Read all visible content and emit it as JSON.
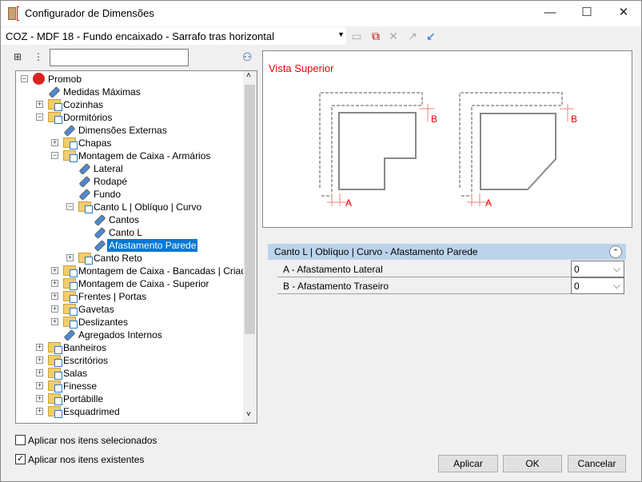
{
  "window": {
    "title": "Configurador de Dimensões",
    "min": "—",
    "max": "☐",
    "close": "✕"
  },
  "toolbar": {
    "combo_value": "COZ - MDF 18 - Fundo encaixado - Sarrafo tras horizontal"
  },
  "search": {
    "value": ""
  },
  "tree": [
    {
      "label": "Promob",
      "level": 0,
      "exp": "-",
      "icon": "logo"
    },
    {
      "label": "Medidas Máximas",
      "level": 1,
      "icon": "tag"
    },
    {
      "label": "Cozinhas",
      "level": 1,
      "exp": "+",
      "icon": "folder"
    },
    {
      "label": "Dormitórios",
      "level": 1,
      "exp": "-",
      "icon": "folder"
    },
    {
      "label": "Dimensões Externas",
      "level": 2,
      "icon": "tag"
    },
    {
      "label": "Chapas",
      "level": 2,
      "exp": "+",
      "icon": "folder"
    },
    {
      "label": "Montagem de Caixa - Armários",
      "level": 2,
      "exp": "-",
      "icon": "folder"
    },
    {
      "label": "Lateral",
      "level": 3,
      "icon": "tag"
    },
    {
      "label": "Rodapé",
      "level": 3,
      "icon": "tag"
    },
    {
      "label": "Fundo",
      "level": 3,
      "icon": "tag"
    },
    {
      "label": "Canto L | Oblíquo | Curvo",
      "level": 3,
      "exp": "-",
      "icon": "folder"
    },
    {
      "label": "Cantos",
      "level": 4,
      "icon": "tag"
    },
    {
      "label": "Canto L",
      "level": 4,
      "icon": "tag"
    },
    {
      "label": "Afastamento Parede",
      "level": 4,
      "icon": "tag",
      "selected": true
    },
    {
      "label": "Canto Reto",
      "level": 3,
      "exp": "+",
      "icon": "folder"
    },
    {
      "label": "Montagem de Caixa - Bancadas | Criados",
      "level": 2,
      "exp": "+",
      "icon": "folder"
    },
    {
      "label": "Montagem de Caixa - Superior",
      "level": 2,
      "exp": "+",
      "icon": "folder"
    },
    {
      "label": "Frentes | Portas",
      "level": 2,
      "exp": "+",
      "icon": "folder"
    },
    {
      "label": "Gavetas",
      "level": 2,
      "exp": "+",
      "icon": "folder"
    },
    {
      "label": "Deslizantes",
      "level": 2,
      "exp": "+",
      "icon": "folder"
    },
    {
      "label": "Agregados Internos",
      "level": 2,
      "icon": "tag"
    },
    {
      "label": "Banheiros",
      "level": 1,
      "exp": "+",
      "icon": "folder"
    },
    {
      "label": "Escritórios",
      "level": 1,
      "exp": "+",
      "icon": "folder"
    },
    {
      "label": "Salas",
      "level": 1,
      "exp": "+",
      "icon": "folder"
    },
    {
      "label": "Finesse",
      "level": 1,
      "exp": "+",
      "icon": "folder"
    },
    {
      "label": "Portábille",
      "level": 1,
      "exp": "+",
      "icon": "folder"
    },
    {
      "label": "Esquadrimed",
      "level": 1,
      "exp": "+",
      "icon": "folder"
    }
  ],
  "preview": {
    "title": "Vista Superior",
    "label_a": "A",
    "label_b": "B"
  },
  "properties": {
    "header": "Canto L | Oblíquo | Curvo - Afastamento Parede",
    "rows": [
      {
        "label": "A - Afastamento Lateral",
        "value": "0"
      },
      {
        "label": "B - Afastamento Traseiro",
        "value": "0"
      }
    ]
  },
  "options": {
    "apply_selected": "Aplicar nos itens selecionados",
    "apply_selected_checked": false,
    "apply_existing": "Aplicar nos itens existentes",
    "apply_existing_checked": true
  },
  "buttons": {
    "apply": "Aplicar",
    "ok": "OK",
    "cancel": "Cancelar"
  }
}
